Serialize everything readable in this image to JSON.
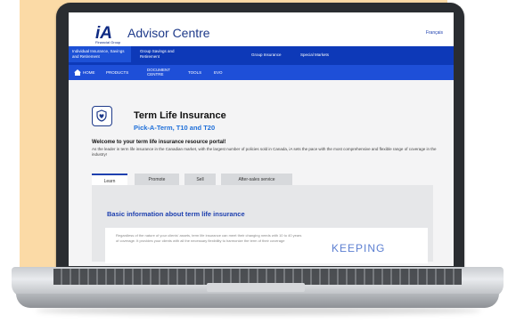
{
  "header": {
    "logo_text": "iA",
    "logo_subtext": "Financial Group",
    "site_title": "Advisor Centre",
    "language_link": "Français"
  },
  "primary_nav": [
    {
      "label": "Individual Insurance, Savings and Retirement",
      "active": true
    },
    {
      "label": "Group Savings and Retirement",
      "active": false
    },
    {
      "label": "Group Insurance",
      "active": false
    },
    {
      "label": "Special Markets",
      "active": false
    }
  ],
  "secondary_nav": [
    {
      "label": "HOME",
      "icon": "home-icon"
    },
    {
      "label": "PRODUCTS"
    },
    {
      "label": "DOCUMENT CENTRE"
    },
    {
      "label": "TOOLS"
    },
    {
      "label": "EVO"
    }
  ],
  "page": {
    "title": "Term Life Insurance",
    "subtitle": "Pick-A-Term, T10 and T20",
    "icon": "heart-shield-icon",
    "welcome": "Welcome to your term life insurance resource portal!",
    "intro": "As the leader in term life insurance in the Canadian market, with the largest number of policies sold in Canada, iA sets the pace with the most comprehensive and flexible range of coverage in the industry!"
  },
  "tabs": [
    {
      "label": "Learn",
      "active": true
    },
    {
      "label": "Promote",
      "active": false
    },
    {
      "label": "Sell",
      "active": false
    },
    {
      "label": "After-sales service",
      "active": false
    }
  ],
  "panel": {
    "title": "Basic information about term life insurance",
    "body": "Regardless of the nature of your clients' assets, term life insurance can meet their changing needs with 10 to 40 years of coverage. It provides your clients with all the necessary flexibility to harmonize the term of their coverage",
    "hero_text": "KEEPING"
  },
  "colors": {
    "brand_blue": "#0d39b8",
    "nav_blue": "#1e4fd8",
    "accent_blue": "#1e6fd9",
    "background_peach": "#fbdaa6"
  }
}
